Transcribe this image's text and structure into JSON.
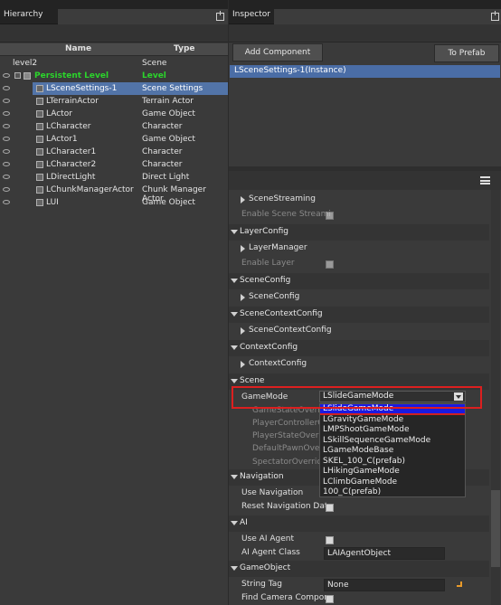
{
  "hierarchy": {
    "tab": "Hierarchy",
    "col_name": "Name",
    "col_type": "Type",
    "rows": [
      {
        "name": "level2",
        "type": "Scene"
      },
      {
        "name": "Persistent Level",
        "type": "Level"
      },
      {
        "name": "LSceneSettings-1",
        "type": "Scene Settings"
      },
      {
        "name": "LTerrainActor",
        "type": "Terrain Actor"
      },
      {
        "name": "LActor",
        "type": "Game Object"
      },
      {
        "name": "LCharacter",
        "type": "Character"
      },
      {
        "name": "LActor1",
        "type": "Game Object"
      },
      {
        "name": "LCharacter1",
        "type": "Character"
      },
      {
        "name": "LCharacter2",
        "type": "Character"
      },
      {
        "name": "LDirectLight",
        "type": "Direct Light"
      },
      {
        "name": "LChunkManagerActor",
        "type": "Chunk Manager Actor"
      },
      {
        "name": "LUI",
        "type": "Game Object"
      }
    ],
    "level_color": "#2bd52b"
  },
  "inspector": {
    "tab": "Inspector",
    "add_component": "Add Component",
    "to_prefab": "To Prefab",
    "instance": "LSceneSettings-1(Instance)",
    "props": {
      "scene_streaming": "SceneStreaming",
      "enable_scene_streaming": "Enable Scene Streami",
      "layer_config": "LayerConfig",
      "layer_manager": "LayerManager",
      "enable_layer": "Enable Layer",
      "scene_config_sec": "SceneConfig",
      "scene_config": "SceneConfig",
      "scene_context_config_sec": "SceneContextConfig",
      "scene_context_config": "SceneContextConfig",
      "context_config_sec": "ContextConfig",
      "context_config": "ContextConfig",
      "scene_sec": "Scene",
      "game_mode": "GameMode",
      "game_state_override": "GameStateOverri",
      "player_controller_override": "PlayerControllerO",
      "player_state_override": "PlayerStateOverri",
      "default_pawn_override": "DefaultPawnOverri",
      "spectator_override": "SpectatorOverrid",
      "navigation_sec": "Navigation",
      "use_navigation": "Use Navigation",
      "reset_navigation_data": "Reset Navigation Data",
      "ai_sec": "AI",
      "use_ai_agent": "Use AI Agent",
      "ai_agent_class": "AI Agent Class",
      "ai_agent_class_value": "LAIAgentObject",
      "game_object_sec": "GameObject",
      "string_tag": "String Tag",
      "string_tag_value": "None",
      "find_camera_component": "Find Camera Compone"
    },
    "game_mode_value": "LSlideGameMode",
    "game_mode_options": [
      "LSlideGameMode",
      "LGravityGameMode",
      "LMPShootGameMode",
      "LSkillSequenceGameMode",
      "LGameModeBase",
      "SKEL_100_C(prefab)",
      "LHikingGameMode",
      "LClimbGameMode",
      "100_C(prefab)"
    ],
    "highlight_color": "#dc1f1f",
    "selected_option_color": "#1a1ae0"
  }
}
